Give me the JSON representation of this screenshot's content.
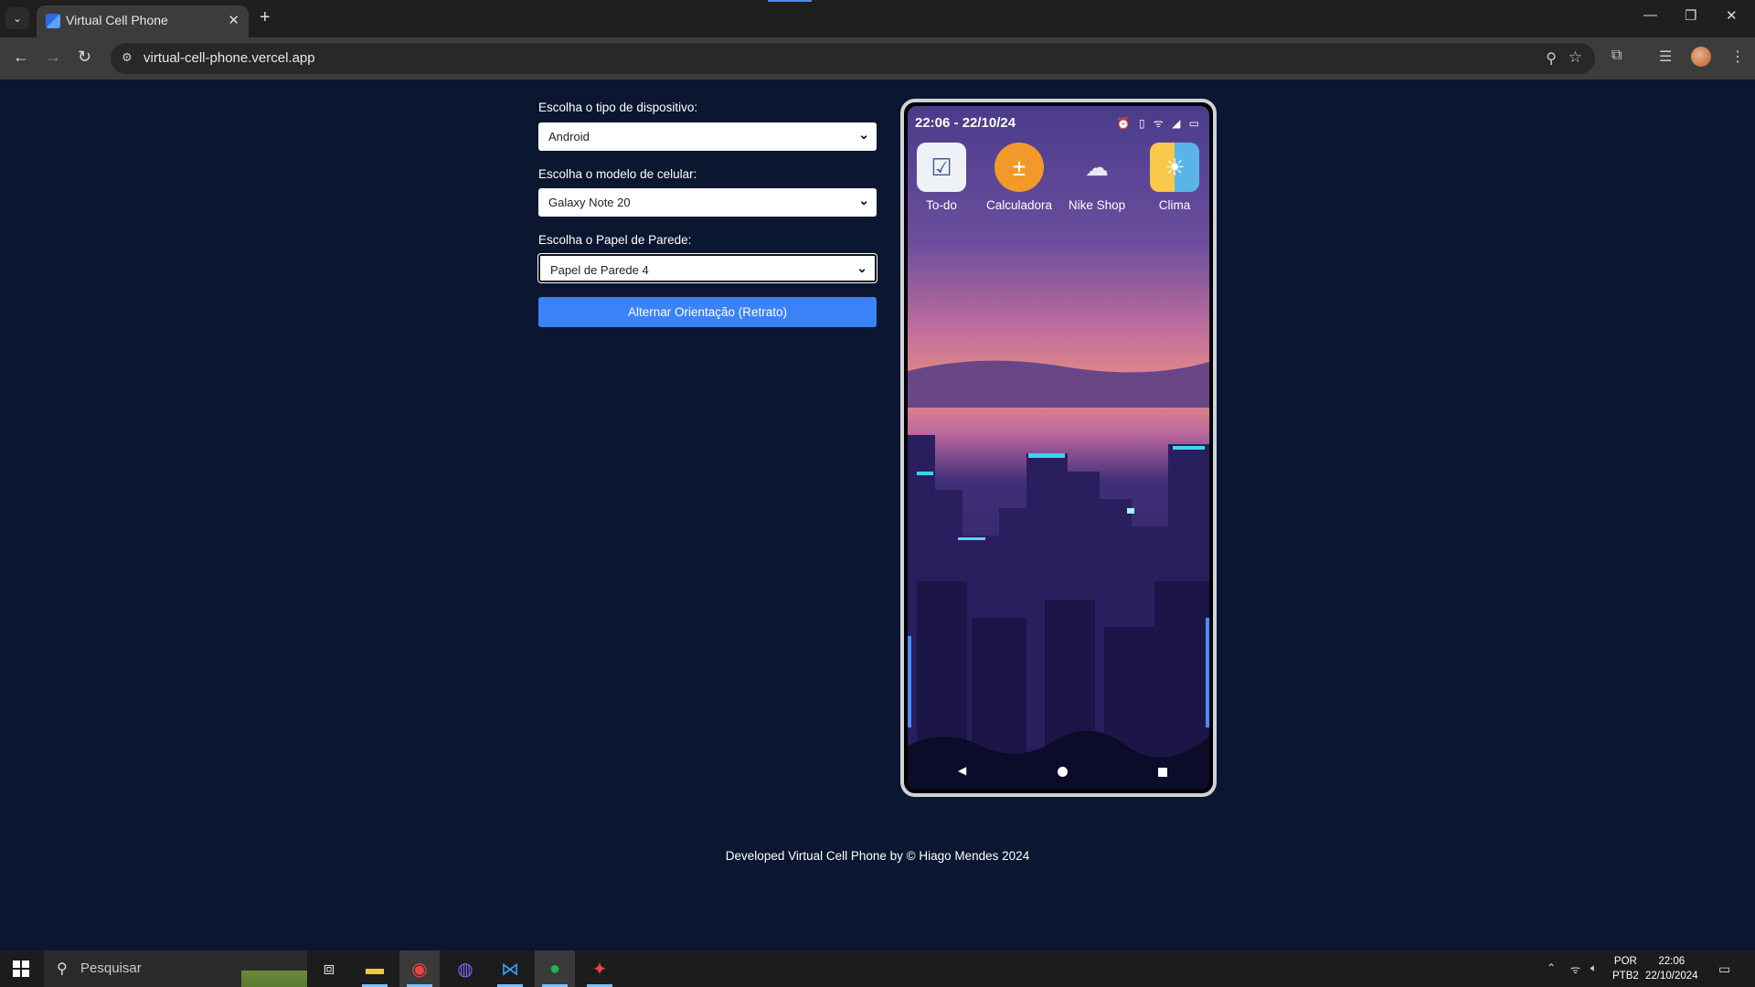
{
  "browser": {
    "tab_title": "Virtual Cell Phone",
    "url": "virtual-cell-phone.vercel.app",
    "new_tab_symbol": "+",
    "close_tab_symbol": "✕"
  },
  "form": {
    "device_type_label": "Escolha o tipo de dispositivo:",
    "device_type_value": "Android",
    "model_label": "Escolha o modelo de celular:",
    "model_value": "Galaxy Note 20",
    "wallpaper_label": "Escolha o Papel de Parede:",
    "wallpaper_value": "Papel de Parede 4",
    "toggle_button_label": "Alternar Orientação (Retrato)"
  },
  "phone": {
    "status_time": "22:06 - 22/10/24",
    "apps": [
      {
        "name": "To-do",
        "icon": "checklist-icon"
      },
      {
        "name": "Calculadora",
        "icon": "calculator-icon"
      },
      {
        "name": "Nike Shop",
        "icon": "sneaker-icon"
      },
      {
        "name": "Clima",
        "icon": "weather-icon"
      }
    ]
  },
  "footer": {
    "text": "Developed Virtual Cell Phone by © Hiago Mendes 2024"
  },
  "taskbar": {
    "search_placeholder": "Pesquisar",
    "language_top": "POR",
    "language_bottom": "PTB2",
    "time": "22:06",
    "date": "22/10/2024"
  },
  "colors": {
    "page_background": "#0b1630",
    "button_blue": "#3b82f6",
    "phone_frame": "#d0d2da"
  }
}
